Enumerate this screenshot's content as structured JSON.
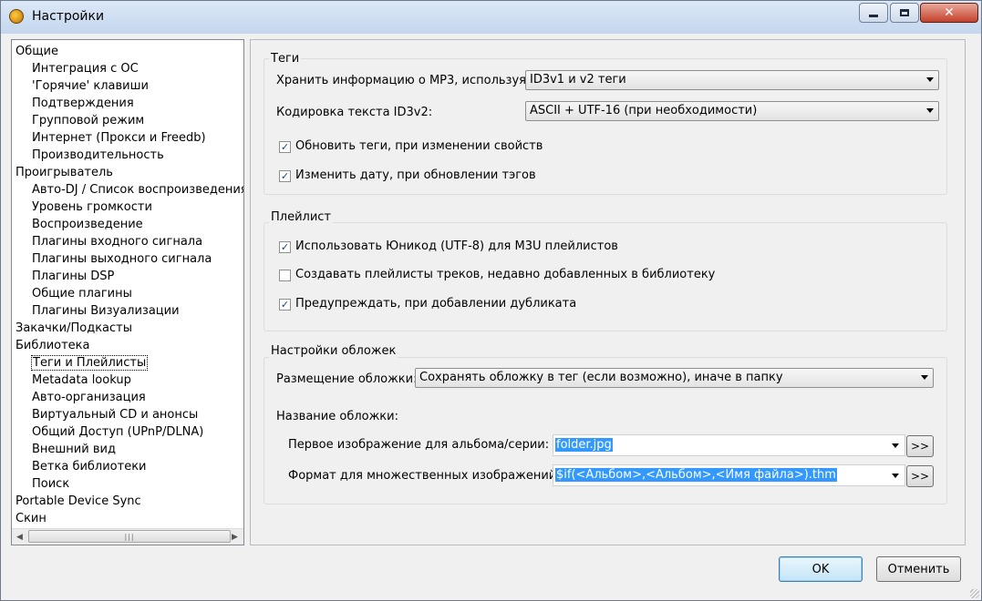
{
  "window": {
    "title": "Настройки"
  },
  "tree": {
    "items": [
      {
        "label": "Общие",
        "level": 0
      },
      {
        "label": "Интеграция с ОС",
        "level": 1
      },
      {
        "label": "'Горячие' клавиши",
        "level": 1
      },
      {
        "label": "Подтверждения",
        "level": 1
      },
      {
        "label": "Групповой режим",
        "level": 1
      },
      {
        "label": "Интернет (Прокси и Freedb)",
        "level": 1
      },
      {
        "label": "Производительность",
        "level": 1
      },
      {
        "label": "Проигрыватель",
        "level": 0
      },
      {
        "label": "Авто-DJ / Список воспроизведения",
        "level": 1
      },
      {
        "label": "Уровень громкости",
        "level": 1
      },
      {
        "label": "Воспроизведение",
        "level": 1
      },
      {
        "label": "Плагины входного сигнала",
        "level": 1
      },
      {
        "label": "Плагины выходного сигнала",
        "level": 1
      },
      {
        "label": "Плагины DSP",
        "level": 1
      },
      {
        "label": "Общие плагины",
        "level": 1
      },
      {
        "label": "Плагины Визуализации",
        "level": 1
      },
      {
        "label": "Закачки/Подкасты",
        "level": 0
      },
      {
        "label": "Библиотека",
        "level": 0
      },
      {
        "label": "Теги и Плейлисты",
        "level": 1,
        "selected": true
      },
      {
        "label": "Metadata lookup",
        "level": 1
      },
      {
        "label": "Авто-организация",
        "level": 1
      },
      {
        "label": "Виртуальный CD и анонсы",
        "level": 1
      },
      {
        "label": "Общий Доступ (UPnP/DLNA)",
        "level": 1
      },
      {
        "label": "Внешний вид",
        "level": 1
      },
      {
        "label": "Ветка библиотеки",
        "level": 1
      },
      {
        "label": "Поиск",
        "level": 1
      },
      {
        "label": "Portable Device Sync",
        "level": 0
      },
      {
        "label": "Скин",
        "level": 0
      }
    ]
  },
  "tags": {
    "title": "Теги",
    "store_label": "Хранить информацию о MP3, используя:",
    "store_value": "ID3v1 и v2 теги",
    "encoding_label": "Кодировка текста ID3v2:",
    "encoding_value": "ASCII + UTF-16 (при необходимости)",
    "update_tags_label": "Обновить теги, при изменении свойств",
    "update_tags_checked": true,
    "change_date_label": "Изменить дату, при обновлении тэгов",
    "change_date_checked": true
  },
  "playlist": {
    "title": "Плейлист",
    "unicode_label": "Использовать Юникод (UTF-8) для M3U плейлистов",
    "unicode_checked": true,
    "create_recent_label": "Создавать плейлисты треков, недавно добавленных в библиотеку",
    "create_recent_checked": false,
    "warn_dup_label": "Предупреждать, при добавлении дубликата",
    "warn_dup_checked": true
  },
  "covers": {
    "title": "Настройки обложек",
    "placement_label": "Размещение обложки:",
    "placement_value": "Сохранять обложку в тег (если возможно), иначе в папку",
    "name_label": "Название обложки:",
    "first_image_label": "Первое изображение для альбома/серии:",
    "first_image_value": "folder.jpg",
    "multi_format_label": "Формат для множественных изображений:",
    "multi_format_value": "$if(<Альбом>,<Альбом>,<Имя файла>).thm",
    "more_button": ">>"
  },
  "buttons": {
    "ok": "OK",
    "cancel": "Отменить"
  }
}
